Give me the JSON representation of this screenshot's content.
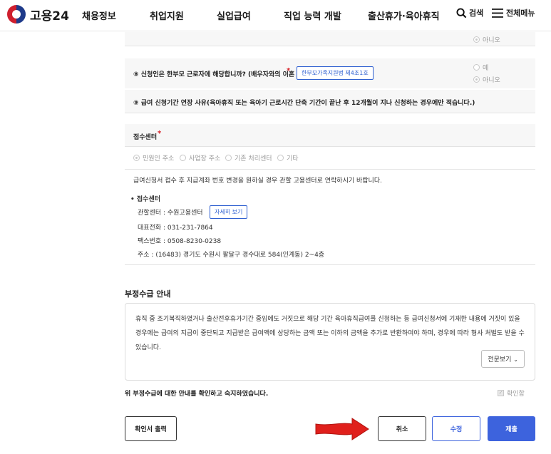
{
  "header": {
    "logo_text": "고용24",
    "nav": [
      "채용정보",
      "취업지원",
      "실업급여",
      "직업 능력 개발",
      "출산휴가·육아휴직"
    ],
    "search_label": "검색",
    "menu_label": "전체메뉴"
  },
  "form": {
    "prev_answer": "아니오",
    "q8": {
      "text": "⑧ 신청인은 한부모 근로자에 해당합니까? (배우자와의 이혼 등)",
      "required_mark": "*",
      "law_button": "한부모가족지원법 제4조1호",
      "options": [
        "예",
        "아니오"
      ]
    },
    "q9": {
      "text": "⑨ 급여 신청기간 연장 사유(육아휴직 또는 육아기 근로시간 단축 기간이 끝난 후 12개월이 지나 신청하는 경우에만 적습니다.)"
    },
    "center": {
      "label": "접수센터",
      "required_mark": "*",
      "options": [
        "민원인 주소",
        "사업장 주소",
        "기존 처리센터",
        "기타"
      ],
      "notice": "급여신청서 접수 후 지급계좌 번호 변경을 원하실 경우 관할 고용센터로 연락하시기 바랍니다.",
      "title": "접수센터",
      "jurisdiction": "관할센터 : 수원고용센터",
      "detail_button": "자세히 보기",
      "phone": "대표전화 : 031-231-7864",
      "fax": "팩스번호 : 0508-8230-0238",
      "address": "주소 : (16483) 경기도 수원시 팔달구 경수대로 584(인계동) 2~4층"
    }
  },
  "fraud": {
    "title": "부정수급 안내",
    "line1": "휴직 중 조기복직하였거나 출산전후휴가기간 중임에도 거짓으로 해당 기간 육아휴직급여를 신청하는 등 급여신청서에 기재한 내용에 거짓이 있을",
    "line2": "경우에는 급여의 지급이 중단되고 지급받은 급여액에 상당하는 금액 또는 이하의 금액을 추가로 반환하여야 하며, 경우에 따라 형사 처벌도 받을 수",
    "line3": "있습니다.",
    "more_button": "전문보기",
    "confirm_text": "위 부정수급에 대한 안내를 확인하고 숙지하였습니다.",
    "confirm_check": "확인함"
  },
  "buttons": {
    "print": "확인서 출력",
    "cancel": "취소",
    "edit": "수정",
    "submit": "제출"
  },
  "colors": {
    "primary": "#3d63dd",
    "arrow": "#e0201c",
    "required": "#d8232a"
  }
}
